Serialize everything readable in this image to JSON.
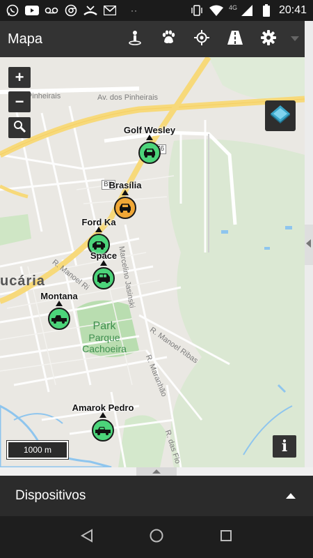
{
  "status_bar": {
    "time": "20:41",
    "network": "4G",
    "overflow": "··",
    "left_icons": [
      "whatsapp-icon",
      "youtube-icon",
      "voicemail-icon",
      "chrome-icon",
      "missed-call-icon",
      "gmail-icon"
    ],
    "right_icons": [
      "vibrate-icon",
      "wifi-icon",
      "signal-icon",
      "battery-icon"
    ]
  },
  "app_bar": {
    "title": "Mapa",
    "actions": [
      "person-pin-icon",
      "paw-icon",
      "crosshair-icon",
      "road-icon",
      "gear-icon",
      "dropdown-caret-icon"
    ]
  },
  "map": {
    "controls": {
      "zoom_in": "+",
      "zoom_out": "−",
      "search_icon": "magnifier-icon",
      "layers_icon": "layers-icon",
      "info": "i"
    },
    "scale": "1000 m",
    "city": "ucária",
    "park": {
      "line1": "Park",
      "line2": "Parque",
      "line3": "Cachoeira"
    },
    "street_labels": {
      "pinheirais_1": "ov. Pinheirais",
      "pinheirais_2": "Av. dos Pinheirais",
      "marcelino": "Marcelino Jasinski",
      "manoel_1": "R. Manoel Ri",
      "manoel_2": "R. Manoel Ribas",
      "maranhao": "R. Maranhão",
      "flores": "R. das Flo"
    },
    "shields": {
      "br476_a": "76",
      "br476_b": "BR"
    },
    "vehicles": [
      {
        "name": "Golf Wesley",
        "status": "moving",
        "color": "#4cd47a"
      },
      {
        "name": "Brasília",
        "status": "stopped",
        "color": "#f0a736"
      },
      {
        "name": "Ford Ka",
        "status": "moving",
        "color": "#4cd47a"
      },
      {
        "name": "Space",
        "status": "moving",
        "color": "#4cd47a"
      },
      {
        "name": "Montana",
        "status": "moving",
        "color": "#4cd47a"
      },
      {
        "name": "Amarok Pedro",
        "status": "moving",
        "color": "#4cd47a"
      }
    ]
  },
  "bottom_panel": {
    "title": "Dispositivos",
    "toggle_icon": "caret-up-icon"
  },
  "nav_bar": {
    "buttons": [
      "back-icon",
      "home-icon",
      "recents-icon"
    ]
  },
  "colors": {
    "app_bar": "#333333",
    "moving": "#4cd47a",
    "stopped": "#f0a736",
    "road_major": "#f7d97a"
  }
}
